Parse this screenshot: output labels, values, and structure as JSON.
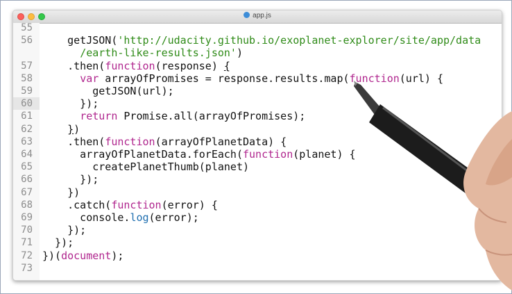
{
  "window": {
    "title": "app.js"
  },
  "editor": {
    "active_line": "60",
    "lines": [
      {
        "n": "55",
        "tokens": []
      },
      {
        "n": "56",
        "tokens": [
          {
            "t": "    getJSON("
          },
          {
            "t": "'http://udacity.github.io/exoplanet-explorer/site/app/data",
            "c": "s"
          }
        ]
      },
      {
        "n": "",
        "tokens": [
          {
            "t": "      "
          },
          {
            "t": "/earth-like-results.json'",
            "c": "s"
          },
          {
            "t": ")"
          }
        ]
      },
      {
        "n": "57",
        "tokens": [
          {
            "t": "    .then("
          },
          {
            "t": "function",
            "c": "k"
          },
          {
            "t": "(response) "
          },
          {
            "t": "{",
            "c": "u"
          }
        ]
      },
      {
        "n": "58",
        "tokens": [
          {
            "t": "      "
          },
          {
            "t": "var",
            "c": "k"
          },
          {
            "t": " arrayOfPromises = response.results.map("
          },
          {
            "t": "function",
            "c": "k"
          },
          {
            "t": "(url) {"
          }
        ]
      },
      {
        "n": "59",
        "tokens": [
          {
            "t": "        getJSON(url);"
          }
        ]
      },
      {
        "n": "60",
        "tokens": [
          {
            "t": "      });"
          }
        ]
      },
      {
        "n": "61",
        "tokens": [
          {
            "t": "      "
          },
          {
            "t": "return",
            "c": "k"
          },
          {
            "t": " Promise.all(arrayOfPromises);"
          }
        ]
      },
      {
        "n": "62",
        "tokens": [
          {
            "t": "    "
          },
          {
            "t": "}",
            "c": "u"
          },
          {
            "t": ")"
          }
        ]
      },
      {
        "n": "63",
        "tokens": [
          {
            "t": "    .then("
          },
          {
            "t": "function",
            "c": "k"
          },
          {
            "t": "(arrayOfPlanetData) {"
          }
        ]
      },
      {
        "n": "64",
        "tokens": [
          {
            "t": "      arrayOfPlanetData.forEach("
          },
          {
            "t": "function",
            "c": "k"
          },
          {
            "t": "(planet) {"
          }
        ]
      },
      {
        "n": "65",
        "tokens": [
          {
            "t": "        createPlanetThumb(planet)"
          }
        ]
      },
      {
        "n": "66",
        "tokens": [
          {
            "t": "      });"
          }
        ]
      },
      {
        "n": "67",
        "tokens": [
          {
            "t": "    })"
          }
        ]
      },
      {
        "n": "68",
        "tokens": [
          {
            "t": "    .catch("
          },
          {
            "t": "function",
            "c": "k"
          },
          {
            "t": "(error) {"
          }
        ]
      },
      {
        "n": "69",
        "tokens": [
          {
            "t": "      console."
          },
          {
            "t": "log",
            "c": "f"
          },
          {
            "t": "(error);"
          }
        ]
      },
      {
        "n": "70",
        "tokens": [
          {
            "t": "    });"
          }
        ]
      },
      {
        "n": "71",
        "tokens": [
          {
            "t": "  });"
          }
        ]
      },
      {
        "n": "72",
        "tokens": [
          {
            "t": "})("
          },
          {
            "t": "document",
            "c": "k"
          },
          {
            "t": ");"
          }
        ]
      },
      {
        "n": "73",
        "tokens": []
      }
    ]
  },
  "colors": {
    "keyword": "#b0268e",
    "string": "#2f8b18",
    "function_call": "#1f6fb0",
    "text": "#111111",
    "line_number": "#8c8c8c"
  }
}
